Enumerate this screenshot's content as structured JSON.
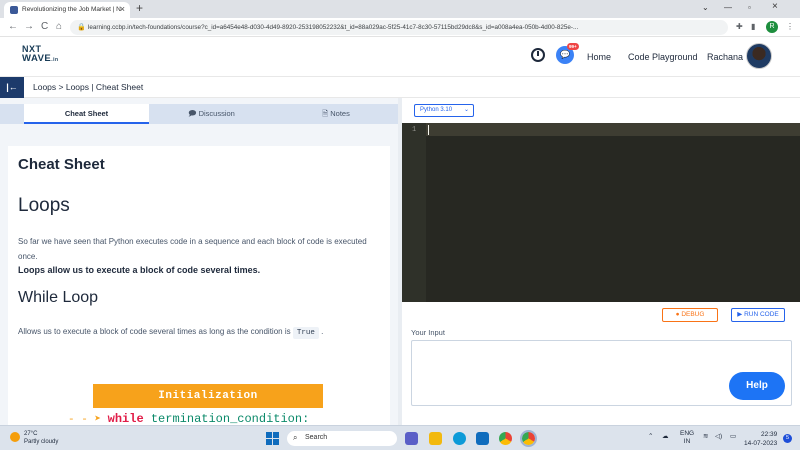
{
  "browser": {
    "tab_title": "Revolutionizing the Job Market | N",
    "tab_close": "×",
    "new_tab": "+",
    "url": "learning.ccbp.in/tech-foundations/course?c_id=a6454e48-d030-4d49-8920-253198052232&t_id=88a029ac-5f25-41c7-8c30-57115bd29dc8&s_id=a008a4ea-050b-4d00-825e-...",
    "profile_initial": "R",
    "back": "←",
    "forward": "→",
    "reload": "C",
    "home": "⌂",
    "minimize": "—",
    "maximize": "▫",
    "close": "×",
    "tabsearch": "⌄"
  },
  "header": {
    "logo_line1": "NXT",
    "logo_line2": "WAVE",
    "logo_tld": ".in",
    "chat_badge": "99+",
    "home": "Home",
    "code_playground": "Code Playground",
    "user_name": "Rachana"
  },
  "breadcrumb": {
    "toggle": "|←",
    "text": "Loops > Loops | Cheat Sheet"
  },
  "left_tabs": [
    {
      "label": "Cheat Sheet",
      "icon": ""
    },
    {
      "label": "Discussion",
      "icon": "🗩"
    },
    {
      "label": "Notes",
      "icon": "🗎"
    }
  ],
  "content": {
    "title": "Cheat Sheet",
    "loops_heading": "Loops",
    "para1": "So far we have seen that Python executes code in a sequence and each block of code is executed once.",
    "para2": "Loops allow us to execute a block of code several times.",
    "while_heading": "While Loop",
    "para3_pre": "Allows us to execute a block of code several times as long as the condition is",
    "para3_code": "True",
    "para3_post": ".",
    "diagram_init": "Initialization",
    "diagram_kw": "while",
    "diagram_cond": "termination_condition:"
  },
  "editor": {
    "language": "Python 3.10",
    "line_number": "1",
    "debug_label": "DEBUG",
    "run_label": "RUN CODE",
    "input_label": "Your Input",
    "help_label": "Help"
  },
  "taskbar": {
    "temperature": "27°C",
    "weather": "Partly cloudy",
    "search_placeholder": "Search",
    "lang_line1": "ENG",
    "lang_line2": "IN",
    "time": "22:39",
    "date": "14-07-2023",
    "notification_count": "5"
  }
}
